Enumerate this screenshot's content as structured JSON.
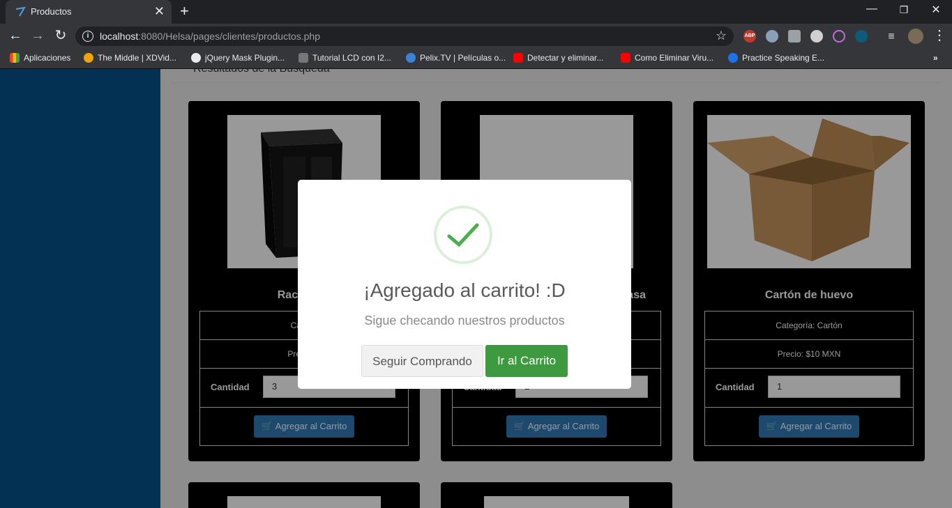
{
  "browser": {
    "tab_title": "Productos",
    "url_host": "localhost",
    "url_rest": ":8080/Helsa/pages/clientes/productos.php",
    "bookmarks": [
      "Aplicaciones",
      "The Middle | XDVid...",
      "jQuery Mask Plugin...",
      "Tutorial LCD con I2...",
      "Pelix.TV | Películas o...",
      "Detectar y eliminar...",
      "Como Eliminar Viru...",
      "Practice Speaking E..."
    ],
    "ext_abp": "ABP"
  },
  "page": {
    "panel_heading": "Resultados de la Búsqueda"
  },
  "products": [
    {
      "name": "Rack para",
      "category": "Catego",
      "price": "Precio: $",
      "qty_label": "Cantidad",
      "qty": "3",
      "add_label": "Agregar al Carrito"
    },
    {
      "name": "asa",
      "category": "",
      "price": "",
      "qty_label": "Cantidad",
      "qty": "2",
      "add_label": "Agregar al Carrito"
    },
    {
      "name": "Cartón de huevo",
      "category": "Categoría: Cartón",
      "price": "Precio: $10 MXN",
      "qty_label": "Cantidad",
      "qty": "1",
      "add_label": "Agregar al Carrito"
    }
  ],
  "modal": {
    "title": "¡Agregado al carrito! :D",
    "text": "Sigue checando nuestros productos",
    "cancel_label": "Seguir Comprando",
    "confirm_label": "Ir al Carrito"
  },
  "colors": {
    "sidebar": "#05528c",
    "add_button": "#337ab7",
    "confirm_button": "#3e9a3e",
    "check": "#4cae4c"
  }
}
